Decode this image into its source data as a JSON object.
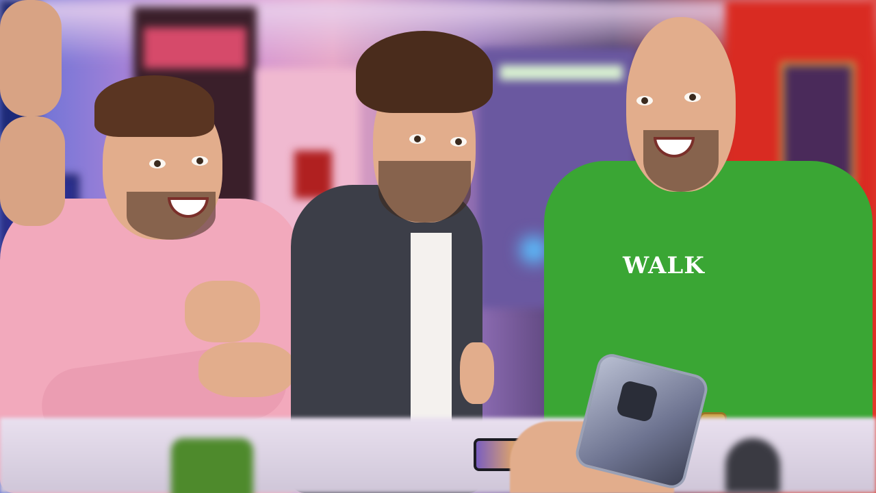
{
  "scene": {
    "shirt_text": "WALK"
  },
  "colors": {
    "pink_sweater": "#f2a9bc",
    "denim_shirt": "#3c3e48",
    "green_shirt": "#3aa634",
    "red_wall": "#d92b22"
  }
}
